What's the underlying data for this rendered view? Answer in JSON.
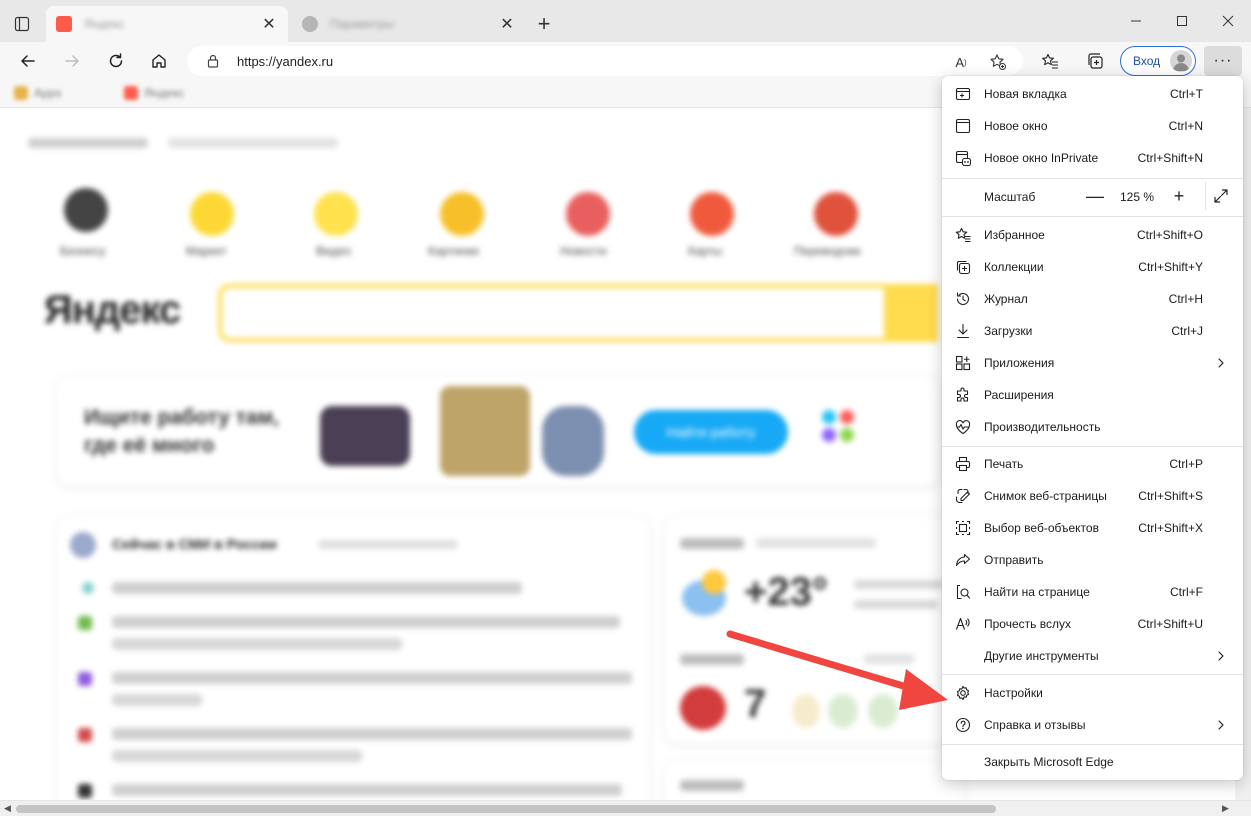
{
  "browser": {
    "accent": "#2f6fd1",
    "tabs": [
      {
        "title": "Яндекс",
        "favicon_color": "#ff5b4a",
        "active": true
      },
      {
        "title": "Параметры",
        "favicon_color": "#9a9a9a",
        "active": false
      }
    ],
    "address": {
      "url": "https://yandex.ru"
    },
    "login_label": "Вход",
    "favorites": [
      {
        "label": "Apps",
        "color": "#e8b24a"
      },
      {
        "label": "Яндекс",
        "color": "#ff5b4a"
      }
    ]
  },
  "menu": {
    "items_top": [
      {
        "label": "Новая вкладка",
        "shortcut": "Ctrl+T",
        "icon": "new-tab-icon"
      },
      {
        "label": "Новое окно",
        "shortcut": "Ctrl+N",
        "icon": "new-window-icon"
      },
      {
        "label": "Новое окно InPrivate",
        "shortcut": "Ctrl+Shift+N",
        "icon": "inprivate-icon"
      }
    ],
    "zoom": {
      "label": "Масштаб",
      "minus": "—",
      "value": "125 %",
      "plus": "+"
    },
    "items_mid": [
      {
        "label": "Избранное",
        "shortcut": "Ctrl+Shift+O",
        "icon": "favorites-icon"
      },
      {
        "label": "Коллекции",
        "shortcut": "Ctrl+Shift+Y",
        "icon": "collections-icon"
      },
      {
        "label": "Журнал",
        "shortcut": "Ctrl+H",
        "icon": "history-icon"
      },
      {
        "label": "Загрузки",
        "shortcut": "Ctrl+J",
        "icon": "download-icon"
      },
      {
        "label": "Приложения",
        "shortcut": "",
        "icon": "apps-icon"
      },
      {
        "label": "Расширения",
        "shortcut": "",
        "icon": "extensions-icon"
      },
      {
        "label": "Производительность",
        "shortcut": "",
        "icon": "performance-icon"
      }
    ],
    "items_tools": [
      {
        "label": "Печать",
        "shortcut": "Ctrl+P",
        "icon": "print-icon"
      },
      {
        "label": "Снимок веб-страницы",
        "shortcut": "Ctrl+Shift+S",
        "icon": "screenshot-icon"
      },
      {
        "label": "Выбор веб-объектов",
        "shortcut": "Ctrl+Shift+X",
        "icon": "web-select-icon"
      },
      {
        "label": "Отправить",
        "shortcut": "",
        "icon": "share-icon"
      },
      {
        "label": "Найти на странице",
        "shortcut": "Ctrl+F",
        "icon": "find-icon"
      },
      {
        "label": "Прочесть вслух",
        "shortcut": "Ctrl+Shift+U",
        "icon": "read-aloud-icon"
      },
      {
        "label": "Другие инструменты",
        "shortcut": "",
        "icon": ""
      }
    ],
    "items_bottom": [
      {
        "label": "Настройки",
        "shortcut": "",
        "icon": "settings-icon"
      },
      {
        "label": "Справка и отзывы",
        "shortcut": "",
        "icon": "help-icon"
      }
    ],
    "close_label": "Закрыть Microsoft Edge"
  },
  "page": {
    "logo": "Яндекс",
    "weather_temp": "+23°",
    "services": [
      "Бизнесу",
      "Маркет",
      "Видео",
      "Картинки",
      "Новости",
      "Карты",
      "Переводчик"
    ],
    "news_header": "Сейчас в СМИ в России",
    "ad_text": "Ищите работу там, где её много",
    "ad_button": "Найти работу"
  },
  "annotation": {
    "arrow_color": "#f0463f"
  }
}
